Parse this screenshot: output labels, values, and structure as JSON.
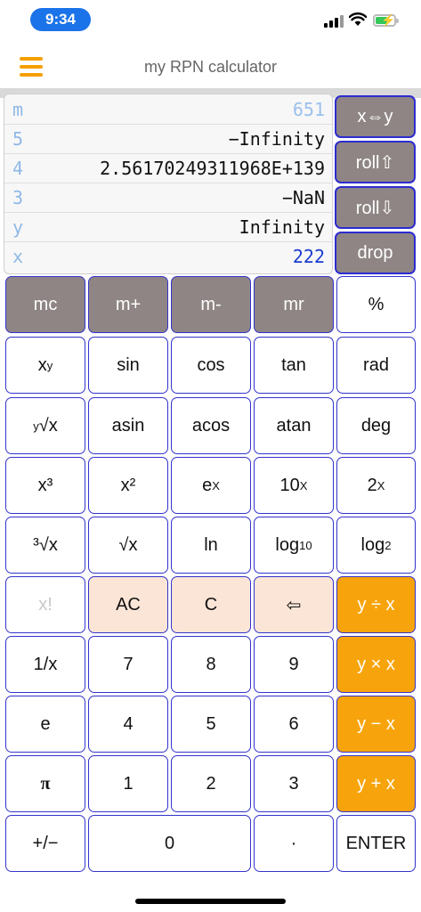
{
  "status": {
    "time": "9:34"
  },
  "header": {
    "title": "my RPN calculator",
    "menu_icon": "hamburger-menu-icon",
    "accent": "#f5a000"
  },
  "stack": [
    {
      "reg": "m",
      "value": "651"
    },
    {
      "reg": "5",
      "value": "−Infinity"
    },
    {
      "reg": "4",
      "value": "2.56170249311968E+139"
    },
    {
      "reg": "3",
      "value": "−NaN"
    },
    {
      "reg": "y",
      "value": "Infinity"
    },
    {
      "reg": "x",
      "value": "222"
    }
  ],
  "side_buttons": {
    "swap": "x⇔y",
    "roll_up": "roll⇧",
    "roll_down": "roll⇩",
    "drop": "drop"
  },
  "keys": {
    "mc": "mc",
    "mplus": "m+",
    "mminus": "m-",
    "mr": "mr",
    "percent": "%",
    "xpowy_base": "x",
    "xpowy_exp": "y",
    "sin": "sin",
    "cos": "cos",
    "tan": "tan",
    "rad": "rad",
    "yroot_index": "y",
    "yroot_rad": "√x",
    "asin": "asin",
    "acos": "acos",
    "atan": "atan",
    "deg": "deg",
    "cube": "x³",
    "square": "x²",
    "exp_base": "e",
    "exp_exp": "X",
    "ten_base": "10",
    "ten_exp": "X",
    "two_base": "2",
    "two_exp": "X",
    "cbrt_index": "³",
    "cbrt_rad": "√x",
    "sqrt": "√x",
    "ln": "ln",
    "log10_base": "log",
    "log10_sub": "10",
    "log2_base": "log",
    "log2_sub": "2",
    "factorial": "x!",
    "ac": "AC",
    "c": "C",
    "backspace": "⇦",
    "divide": "y ÷ x",
    "reciprocal": "1/x",
    "seven": "7",
    "eight": "8",
    "nine": "9",
    "multiply": "y × x",
    "e": "e",
    "four": "4",
    "five": "5",
    "six": "6",
    "subtract": "y − x",
    "pi": "π",
    "one": "1",
    "two": "2",
    "three": "3",
    "add": "y + x",
    "negate": "+/−",
    "zero": "0",
    "dot": "·",
    "enter": "ENTER"
  },
  "colors": {
    "key_border": "#3333cc",
    "memory_key": "#8f8585",
    "clear_key": "#fbe5d6",
    "operator_key": "#f7a40c",
    "x_value": "#1a3ad0"
  }
}
